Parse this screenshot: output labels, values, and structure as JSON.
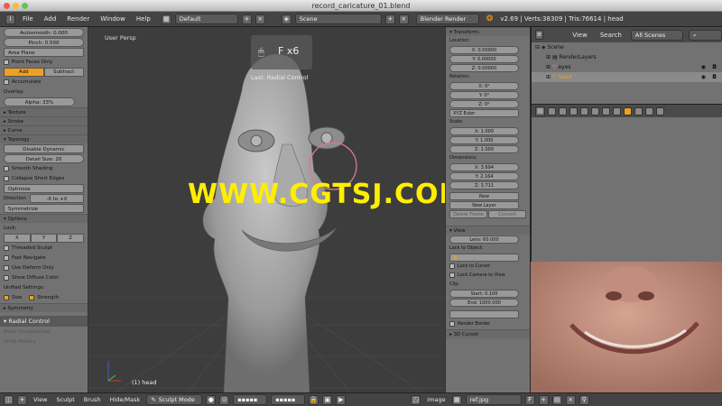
{
  "window": {
    "title": "record_caricature_01.blend"
  },
  "topbar": {
    "menus": [
      "File",
      "Add",
      "Render",
      "Window",
      "Help"
    ],
    "screen_layout": "Default",
    "scene": "Scene",
    "render_engine": "Blender Render",
    "stats": "v2.69 | Verts:38309 | Tris:76614 | head"
  },
  "left_panel": {
    "autosmooth": "Autosmooth: 0.000",
    "pinch": "Pinch: 0.500",
    "area_plane": "Area Plane",
    "front_faces_only": "Front Faces Only",
    "add": "Add",
    "subtract": "Subtract",
    "accumulate": "Accumulate",
    "overlay": "Overlay:",
    "alpha": "Alpha: 33%",
    "texture": "Texture",
    "stroke": "Stroke",
    "curve": "Curve",
    "topology": "Topology",
    "disable_dynamic": "Disable Dynamic",
    "detail_size": "Detail Size: 20",
    "smooth_shading": "Smooth Shading",
    "collapse_short_edges": "Collapse Short Edges",
    "optimize": "Optimize",
    "direction_label": "Direction",
    "direction_value": "-X to +X",
    "symmetrize": "Symmetrize",
    "options": "Options",
    "lock": "Lock:",
    "x": "X",
    "y": "Y",
    "z": "Z",
    "threaded_sculpt": "Threaded Sculpt",
    "fast_navigate": "Fast Navigate",
    "use_deform_only": "Use Deform Only",
    "show_diffuse_color": "Show Diffuse Color",
    "unified_settings": "Unified Settings:",
    "size": "Size",
    "strength": "Strength",
    "symmetry": "Symmetry",
    "radial_control": "Radial Control",
    "redo_unsupported": "Redo Unsupported",
    "undo_history": "Undo History"
  },
  "viewport": {
    "view_label": "User Persp",
    "operator_overlay": "F x6",
    "last_operator": "Last: Radial Control",
    "object_label": "(1) head"
  },
  "watermark": "WWW.CGTSJ.COM",
  "right_panel": {
    "transform": "Transform:",
    "location": "Location:",
    "loc_x": "X: 0.00000",
    "loc_y": "Y: 0.00000",
    "loc_z": "Z: 0.00000",
    "rotation": "Rotation:",
    "rot_x": "X: 0°",
    "rot_y": "Y: 0°",
    "rot_z": "Z: 0°",
    "euler": "XYZ Euler",
    "scale": "Scale:",
    "scale_x": "X: 1.000",
    "scale_y": "Y: 1.000",
    "scale_z": "Z: 1.000",
    "dimensions": "Dimensions:",
    "dim_x": "X: 3.694",
    "dim_y": "Y: 2.164",
    "dim_z": "Z: 3.711",
    "new": "New",
    "new_layer": "New Layer",
    "delete_frame": "Delete Frame",
    "convert": "Convert",
    "view": "View",
    "lens": "Lens: 60.000",
    "lock_to_object": "Lock to Object:",
    "lock_to_cursor": "Lock to Cursor",
    "lock_camera_to_view": "Lock Camera to View",
    "clip": "Clip:",
    "clip_start": "Start: 0.100",
    "clip_end": "End: 1000.000",
    "render_border": "Render Border",
    "3d_cursor": "3D Cursor"
  },
  "outliner": {
    "view": "View",
    "search": "Search",
    "all_scenes": "All Scenes",
    "scene": "Scene",
    "render_layers": "RenderLayers",
    "eyes": "eyes",
    "head": "head"
  },
  "bottombar": {
    "view": "View",
    "sculpt": "Sculpt",
    "brush": "Brush",
    "hide_mask": "Hide/Mask",
    "mode": "Sculpt Mode",
    "image": "Image",
    "ref_image": "ref.jpg",
    "f": "F"
  },
  "colors": {
    "accent": "#f0a020",
    "watermark": "#ffee00",
    "panel": "#727272",
    "viewport": "#3d3d3d"
  }
}
